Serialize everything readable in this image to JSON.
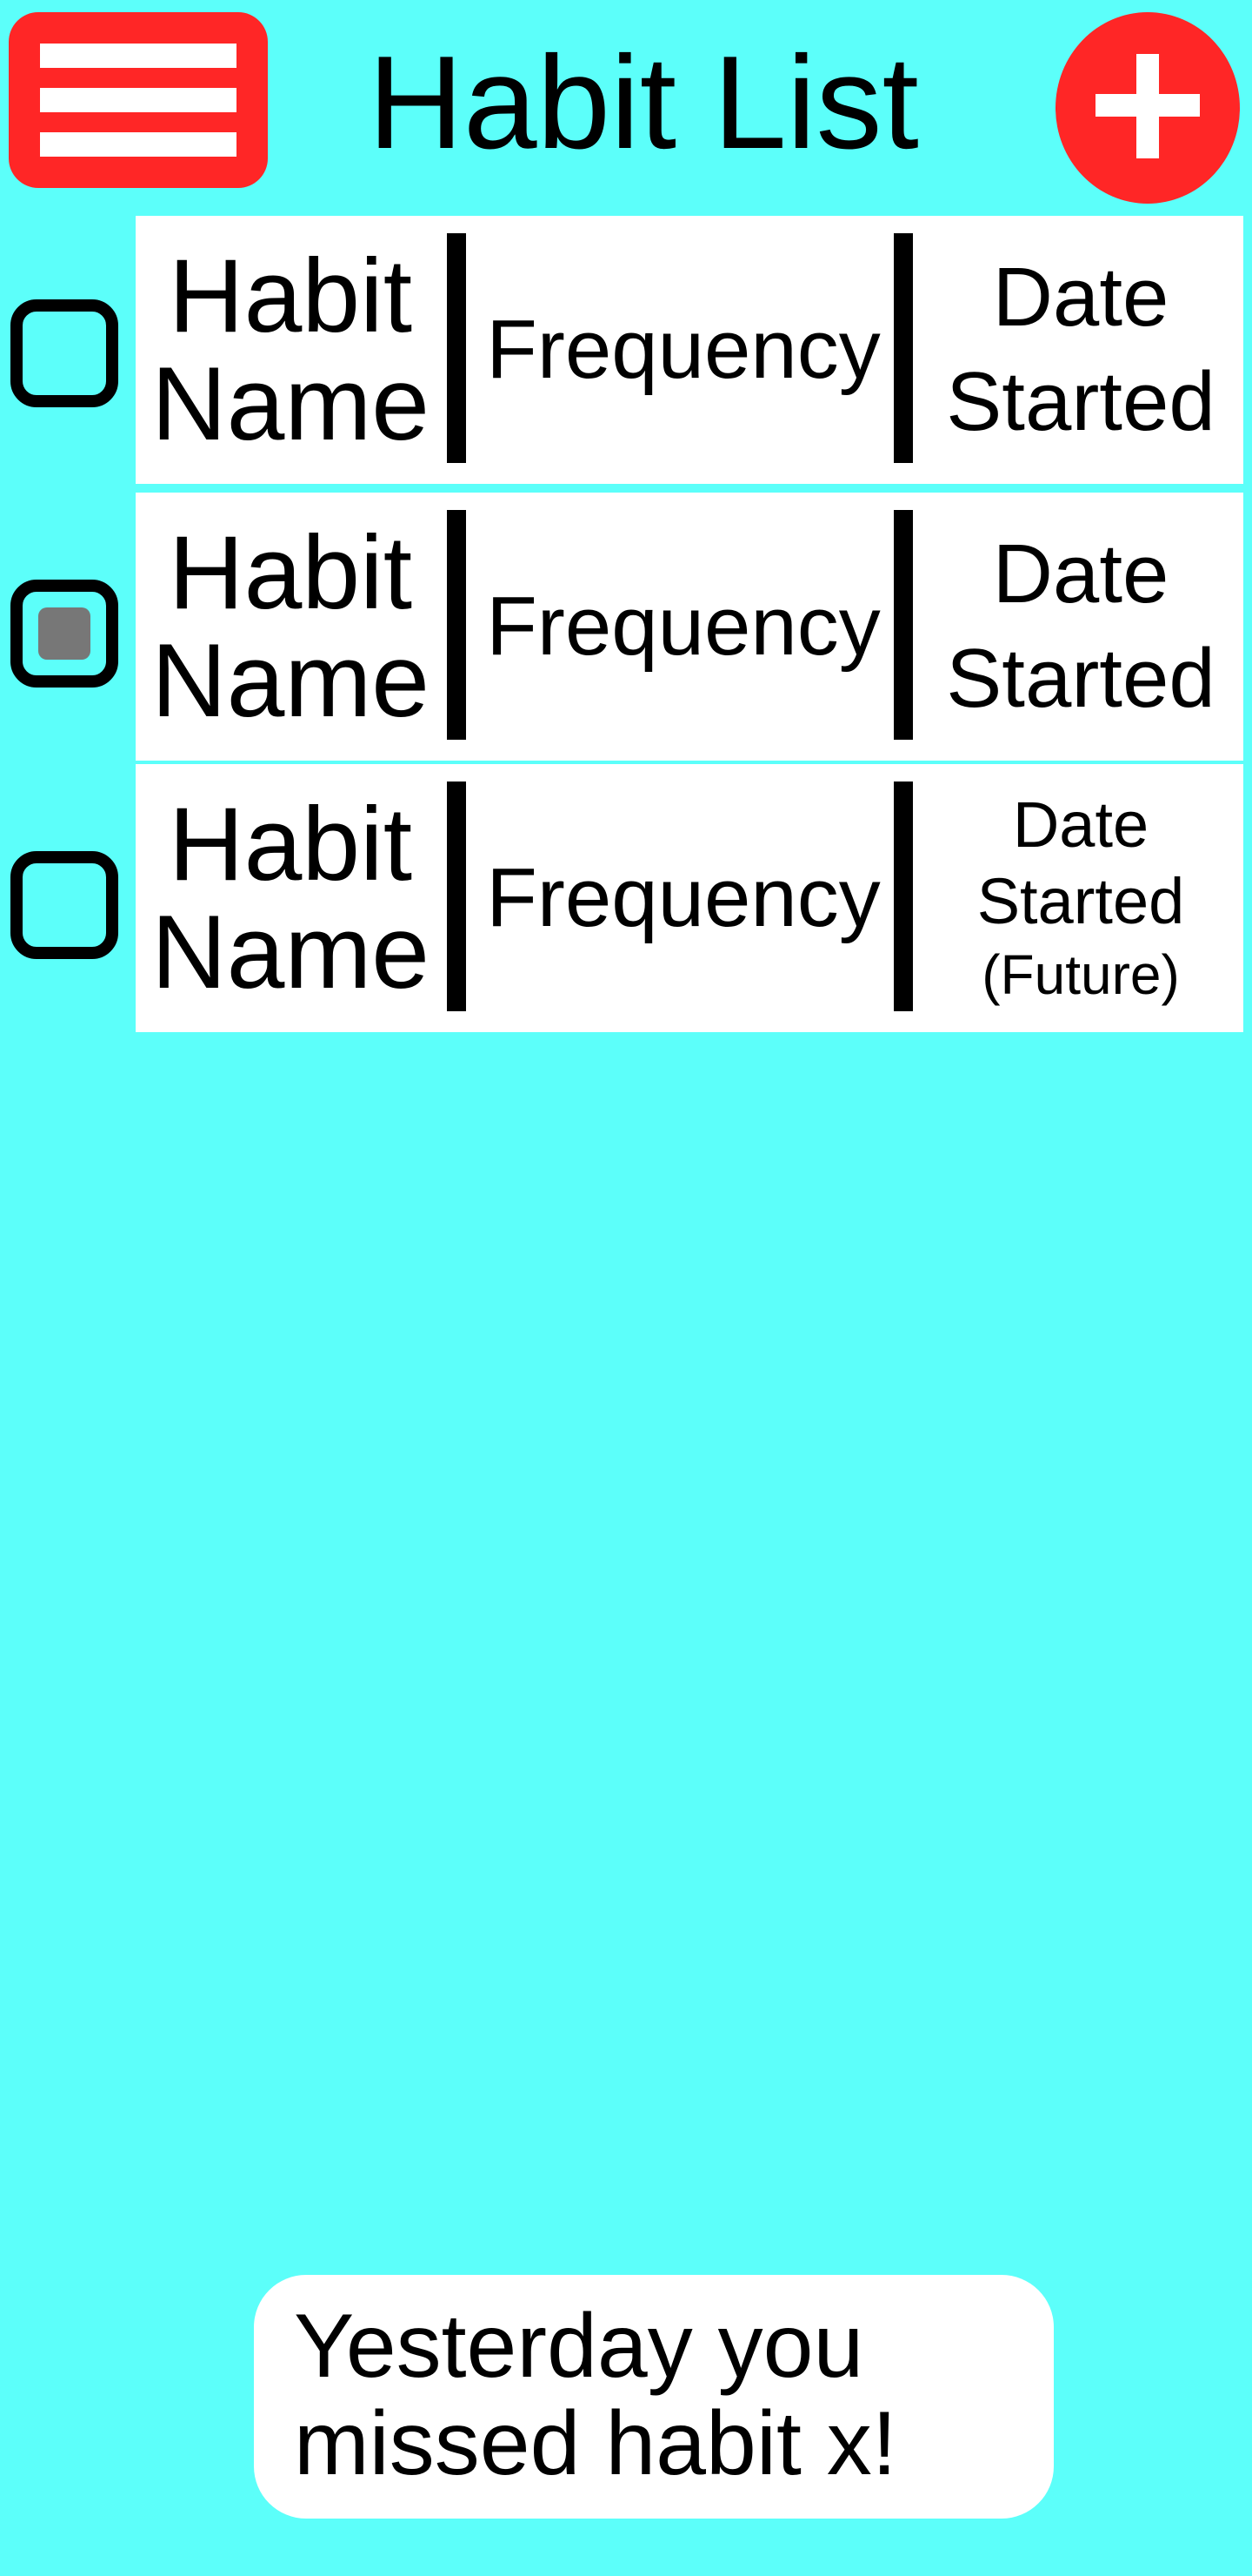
{
  "header": {
    "title": "Habit List",
    "menu_icon": "hamburger-menu-icon",
    "add_icon": "plus-icon"
  },
  "habits": [
    {
      "name_line1": "Habit",
      "name_line2": "Name",
      "frequency": "Frequency",
      "date_line1": "Date",
      "date_line2": "Started",
      "date_note": "",
      "checked": false
    },
    {
      "name_line1": "Habit",
      "name_line2": "Name",
      "frequency": "Frequency",
      "date_line1": "Date",
      "date_line2": "Started",
      "date_note": "",
      "checked": true
    },
    {
      "name_line1": "Habit",
      "name_line2": "Name",
      "frequency": "Frequency",
      "date_line1": "Date",
      "date_line2": "Started",
      "date_note": "(Future)",
      "checked": false
    }
  ],
  "toast": {
    "line1": "Yesterday you",
    "line2": "missed habit x!"
  },
  "colors": {
    "background": "#5cfffa",
    "accent": "#ff2626",
    "card": "#ffffff",
    "checkbox_fill": "#777777"
  }
}
